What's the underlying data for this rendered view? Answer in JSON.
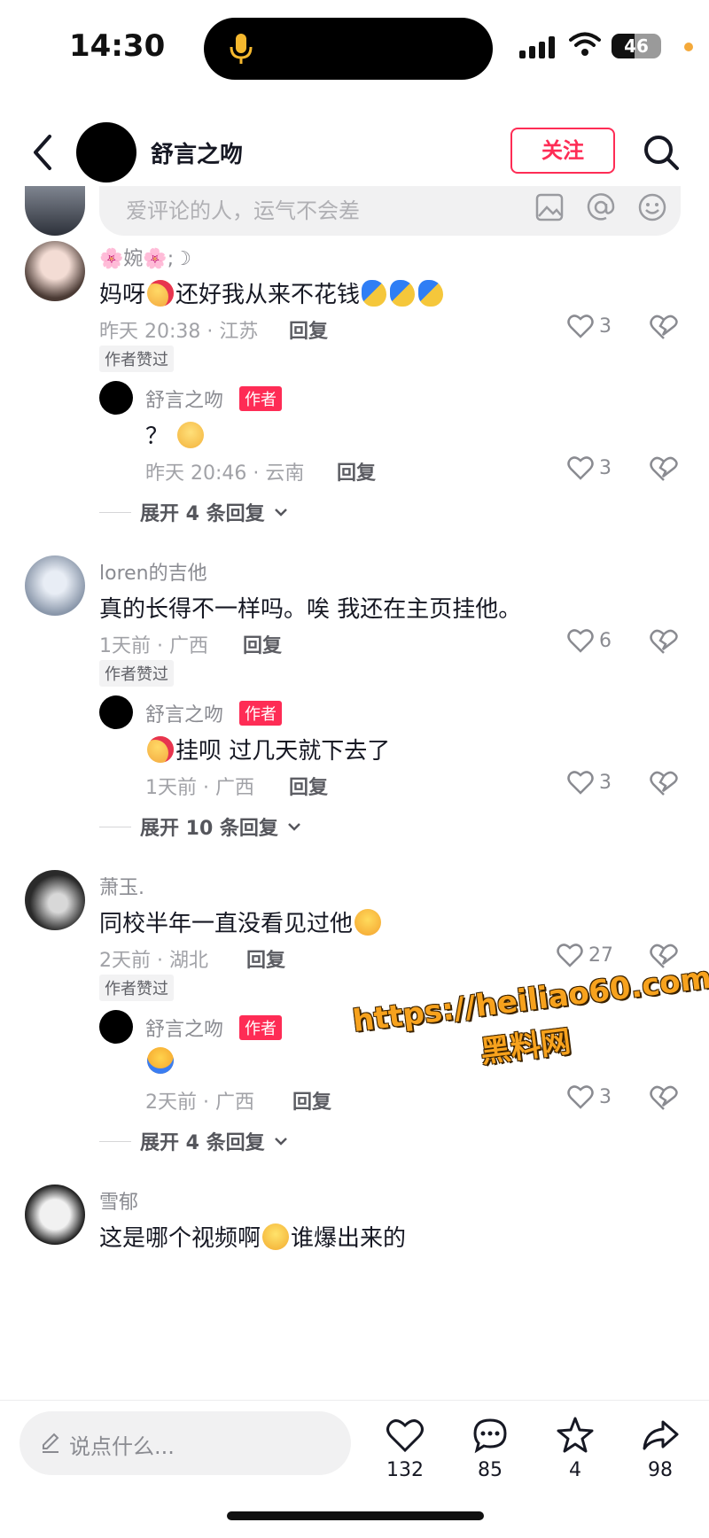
{
  "status_bar": {
    "time": "14:30",
    "battery": "46"
  },
  "header": {
    "title": "舒言之吻",
    "follow_label": "关注"
  },
  "comment_input": {
    "placeholder": "爱评论的人，运气不会差"
  },
  "comments": [
    {
      "user": "🌸婉🌸;☽",
      "text_before": "妈呀",
      "text_after": "还好我从来不花钱",
      "meta": "昨天 20:38 · 江苏",
      "reply_label": "回复",
      "likes": "3",
      "liked_badge": "作者赞过",
      "reply": {
        "user": "舒言之吻",
        "tag": "作者",
        "text": "？",
        "meta": "昨天 20:46 · 云南",
        "reply_label": "回复",
        "likes": "3"
      },
      "expand_label": "展开 4 条回复"
    },
    {
      "user": "loren的吉他",
      "text": "真的长得不一样吗。唉 我还在主页挂他。",
      "meta": "1天前 · 广西",
      "reply_label": "回复",
      "likes": "6",
      "liked_badge": "作者赞过",
      "reply": {
        "user": "舒言之吻",
        "tag": "作者",
        "text": "挂呗 过几天就下去了",
        "meta": "1天前 · 广西",
        "reply_label": "回复",
        "likes": "3"
      },
      "expand_label": "展开 10 条回复"
    },
    {
      "user": "萧玉.",
      "text": "同校半年一直没看见过他",
      "meta": "2天前 · 湖北",
      "reply_label": "回复",
      "likes": "27",
      "liked_badge": "作者赞过",
      "reply": {
        "user": "舒言之吻",
        "tag": "作者",
        "text": "",
        "meta": "2天前 · 广西",
        "reply_label": "回复",
        "likes": "3"
      },
      "expand_label": "展开 4 条回复"
    },
    {
      "user": "雪郁",
      "text_before": "这是哪个视频啊",
      "text_after": "谁爆出来的"
    }
  ],
  "watermark": {
    "url": "https://heiliao60.com",
    "name": "黑料网"
  },
  "bottom_bar": {
    "placeholder": "说点什么...",
    "likes": "132",
    "comments": "85",
    "favorites": "4",
    "shares": "98"
  },
  "colors": {
    "accent": "#fe2c55",
    "text": "#161823",
    "muted": "#8a8b91"
  },
  "icons": [
    "mic-icon",
    "signal-icon",
    "wifi-icon",
    "battery-icon",
    "back-icon",
    "search-icon",
    "image-icon",
    "at-icon",
    "emoji-icon",
    "heart-icon",
    "dislike-icon",
    "chevron-down-icon",
    "pen-icon",
    "comment-icon",
    "star-icon",
    "share-icon"
  ]
}
